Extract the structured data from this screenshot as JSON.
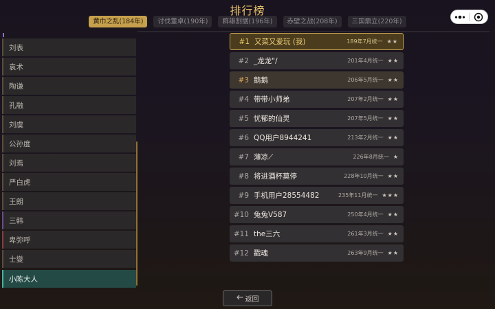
{
  "page_title": "排行榜",
  "tabs": [
    {
      "label": "黄巾之乱(184年)"
    },
    {
      "label": "讨伐董卓(190年)"
    },
    {
      "label": "群雄割据(196年)"
    },
    {
      "label": "赤壁之战(208年)"
    },
    {
      "label": "三国鼎立(220年)"
    }
  ],
  "sidebar": {
    "items": [
      {
        "label": "刘表"
      },
      {
        "label": "袁术"
      },
      {
        "label": "陶谦"
      },
      {
        "label": "孔融"
      },
      {
        "label": "刘虞"
      },
      {
        "label": "公孙度"
      },
      {
        "label": "刘焉"
      },
      {
        "label": "严白虎"
      },
      {
        "label": "王朗"
      },
      {
        "label": "三韩"
      },
      {
        "label": "卑弥呼"
      },
      {
        "label": "士燮"
      },
      {
        "label": "小陈大人"
      }
    ]
  },
  "rankings": [
    {
      "rank": "#1",
      "name": "又菜又爱玩 (我)",
      "meta": "189年7月统一",
      "stars": "★★"
    },
    {
      "rank": "#2",
      "name": "_龙龙\"/",
      "meta": "201年4月统一",
      "stars": "★★"
    },
    {
      "rank": "#3",
      "name": "鹅鹅",
      "meta": "206年5月统一",
      "stars": "★★"
    },
    {
      "rank": "#4",
      "name": "带带小师弟",
      "meta": "207年2月统一",
      "stars": "★★"
    },
    {
      "rank": "#5",
      "name": "忧郁的仙灵",
      "meta": "207年5月统一",
      "stars": "★★"
    },
    {
      "rank": "#6",
      "name": "QQ用户8944241",
      "meta": "213年2月统一",
      "stars": "★★"
    },
    {
      "rank": "#7",
      "name": "薄凉⟋",
      "meta": "226年8月统一",
      "stars": "★"
    },
    {
      "rank": "#8",
      "name": "将进酒杯莫停",
      "meta": "228年10月统一",
      "stars": "★★"
    },
    {
      "rank": "#9",
      "name": "手机用户28554482",
      "meta": "235年11月统一",
      "stars": "★★★"
    },
    {
      "rank": "#10",
      "name": "兔兔V587",
      "meta": "250年4月统一",
      "stars": "★★"
    },
    {
      "rank": "#11",
      "name": "the三六",
      "meta": "261年3月统一",
      "stars": "★★"
    },
    {
      "rank": "#12",
      "name": "戳魂",
      "meta": "263年9月统一",
      "stars": "★★"
    }
  ],
  "back_button": {
    "label": "返回",
    "icon": "arrow-left-icon"
  },
  "capsule": {
    "more_icon": "more-dots-icon",
    "close_icon": "record-close-icon"
  },
  "colors": {
    "accent_gold": "#c6a04c",
    "title_gold": "#e8c26a",
    "active_teal": "#47b3a2",
    "row_bg": "#323033"
  }
}
